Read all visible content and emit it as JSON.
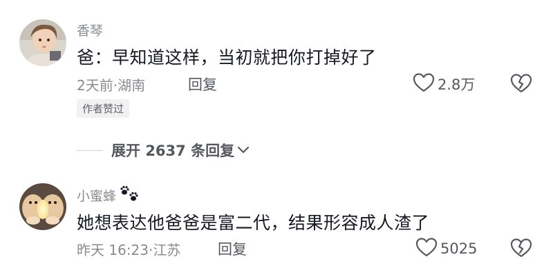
{
  "comments": [
    {
      "username": "香琴",
      "text": "爸：早知道这样，当初就把你打掉好了",
      "meta": "2天前·湖南",
      "reply_label": "回复",
      "likes": "2.8万",
      "badge": "作者赞过"
    },
    {
      "username": "小蜜蜂",
      "text": "她想表达他爸爸是富二代，结果形容成人渣了",
      "meta": "昨天 16:23·江苏",
      "reply_label": "回复",
      "likes": "5025"
    }
  ],
  "expand_replies": "展开 2637 条回复",
  "icons": {
    "like": "heart-outline-icon",
    "dislike": "broken-heart-icon",
    "expand": "chevron-down-icon",
    "username_emoji": "paw-prints-icon"
  },
  "colors": {
    "primary_text": "#161823",
    "secondary_text": "#8a8b91",
    "action_text": "#55575f",
    "badge_bg": "#f1f1f2"
  }
}
